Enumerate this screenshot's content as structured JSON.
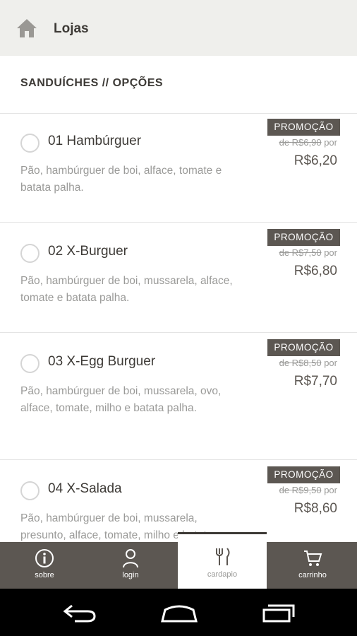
{
  "topbar": {
    "icon": "home-icon",
    "title": "Lojas"
  },
  "section": {
    "title": "SANDUÍCHES // OPÇÕES"
  },
  "items": [
    {
      "name": "01 Hambúrguer",
      "desc": "Pão, hambúrguer de boi, alface, tomate e batata palha.",
      "promo": "PROMOÇÃO",
      "old_prefix": "de ",
      "old_price": "R$6,90",
      "old_suffix": " por",
      "price": "R$6,20"
    },
    {
      "name": "02 X-Burguer",
      "desc": "Pão, hambúrguer de boi, mussarela, alface, tomate e batata palha.",
      "promo": "PROMOÇÃO",
      "old_prefix": "de ",
      "old_price": "R$7,50",
      "old_suffix": " por",
      "price": "R$6,80"
    },
    {
      "name": "03 X-Egg Burguer",
      "desc": "Pão, hambúrguer de boi, mussarela, ovo, alface, tomate, milho e batata palha.",
      "promo": "PROMOÇÃO",
      "old_prefix": "de ",
      "old_price": "R$8,50",
      "old_suffix": " por",
      "price": "R$7,70"
    },
    {
      "name": "04 X-Salada",
      "desc": "Pão, hambúrguer de boi, mussarela, presunto, alface, tomate, milho e batata palha.",
      "promo": "PROMOÇÃO",
      "old_prefix": "de ",
      "old_price": "R$9,50",
      "old_suffix": " por",
      "price": "R$8,60"
    }
  ],
  "bottom_nav": [
    {
      "label": "sobre",
      "icon": "info-icon"
    },
    {
      "label": "login",
      "icon": "user-icon"
    },
    {
      "label": "cardapio",
      "icon": "cutlery-icon",
      "active": true
    },
    {
      "label": "carrinho",
      "icon": "cart-icon"
    }
  ],
  "android_nav": {
    "back": "back-icon",
    "home": "home-nav-icon",
    "recents": "recents-icon"
  },
  "colors": {
    "topbar_bg": "#efefec",
    "accent": "#5c5752",
    "muted_text": "#9a9a98"
  }
}
